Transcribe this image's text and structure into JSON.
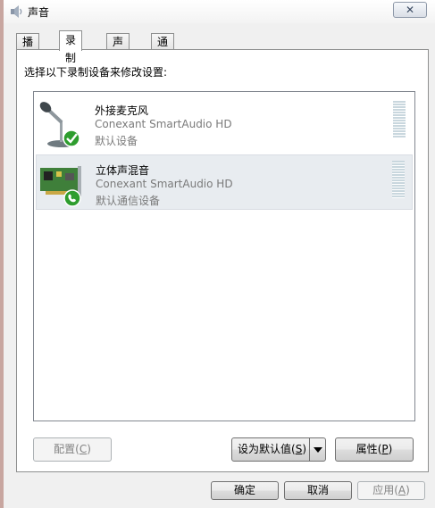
{
  "window": {
    "title": "声音",
    "close_label": "✕"
  },
  "tabs": [
    {
      "label": "播放"
    },
    {
      "label": "录制"
    },
    {
      "label": "声音"
    },
    {
      "label": "通信"
    }
  ],
  "panel": {
    "instruction": "选择以下录制设备来修改设置:"
  },
  "devices": [
    {
      "name": "外接麦克风",
      "driver": "Conexant SmartAudio HD",
      "status": "默认设备",
      "badge_icon": "check-icon",
      "icon": "microphone-icon"
    },
    {
      "name": "立体声混音",
      "driver": "Conexant SmartAudio HD",
      "status": "默认通信设备",
      "badge_icon": "phone-icon",
      "icon": "sound-card-icon"
    }
  ],
  "buttons": {
    "configure_label": "配置",
    "configure_key": "C",
    "set_default_label": "设为默认值",
    "set_default_key": "S",
    "properties_label": "属性",
    "properties_key": "P",
    "ok_label": "确定",
    "cancel_label": "取消",
    "apply_label": "应用",
    "apply_key": "A"
  },
  "colors": {
    "badge_green": "#2e9d2e",
    "selected_row": "#e8ecf0"
  }
}
